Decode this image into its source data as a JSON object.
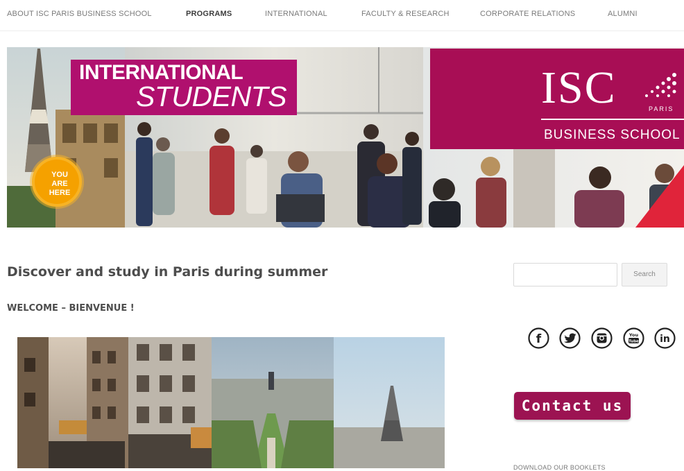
{
  "nav": {
    "items": [
      {
        "label": "ABOUT ISC PARIS BUSINESS SCHOOL",
        "active": false
      },
      {
        "label": "PROGRAMS",
        "active": true
      },
      {
        "label": "INTERNATIONAL",
        "active": false
      },
      {
        "label": "FACULTY & RESEARCH",
        "active": false
      },
      {
        "label": "CORPORATE RELATIONS",
        "active": false
      },
      {
        "label": "ALUMNI",
        "active": false
      }
    ]
  },
  "banner": {
    "title_line1": "INTERNATIONAL",
    "title_line2": "STUDENTS",
    "logo_text": "ISC",
    "logo_city": "PARIS",
    "logo_subtitle": "BUSINESS SCHOOL",
    "badge_text": [
      "YOU",
      "ARE",
      "HERE"
    ],
    "colors": {
      "magenta": "#b0106e",
      "burgundy": "#a80e55",
      "badge": "#f5a100"
    }
  },
  "main": {
    "headline": "Discover and study in Paris during summer",
    "welcome": "WELCOME – BIENVENUE !"
  },
  "sidebar": {
    "search": {
      "placeholder": "",
      "button_label": "Search"
    },
    "social": [
      {
        "name": "facebook",
        "glyph": "f"
      },
      {
        "name": "twitter",
        "glyph": "t"
      },
      {
        "name": "instagram",
        "glyph": "ig"
      },
      {
        "name": "youtube",
        "glyph": "You"
      },
      {
        "name": "linkedin",
        "glyph": "in"
      }
    ],
    "contact_label": "Contact us",
    "download_label": "DOWNLOAD OUR BOOKLETS",
    "contact_color": "#9c1352"
  }
}
